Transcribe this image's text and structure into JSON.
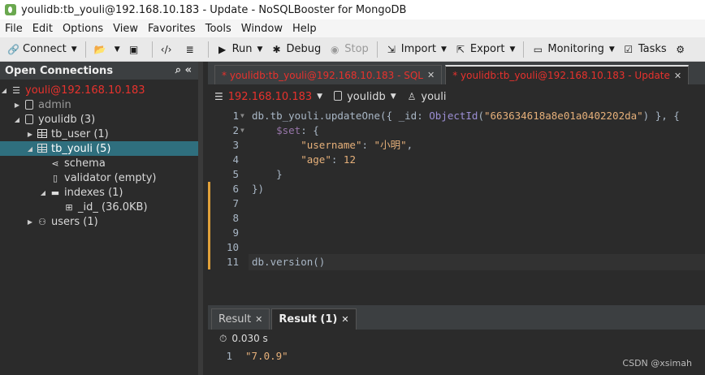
{
  "window": {
    "title": "youlidb:tb_youli@192.168.10.183 - Update - NoSQLBooster for MongoDB"
  },
  "menu": [
    "File",
    "Edit",
    "Options",
    "View",
    "Favorites",
    "Tools",
    "Window",
    "Help"
  ],
  "toolbar": {
    "connect": "Connect",
    "run": "Run",
    "debug": "Debug",
    "stop": "Stop",
    "import": "Import",
    "export": "Export",
    "monitoring": "Monitoring",
    "tasks": "Tasks"
  },
  "left_panel": {
    "title": "Open Connections",
    "tree": [
      {
        "label": "youli@192.168.10.183"
      },
      {
        "label": "admin"
      },
      {
        "label": "youlidb (3)"
      },
      {
        "label": "tb_user (1)"
      },
      {
        "label": "tb_youli (5)"
      },
      {
        "label": "schema"
      },
      {
        "label": "validator (empty)"
      },
      {
        "label": "indexes (1)"
      },
      {
        "label": "_id_ (36.0KB)"
      },
      {
        "label": "users (1)"
      }
    ]
  },
  "tabs": [
    {
      "label": "* youlidb:tb_youli@192.168.10.183 - SQL"
    },
    {
      "label": "* youlidb:tb_youli@192.168.10.183 - Update"
    }
  ],
  "connbar": {
    "host": "192.168.10.183",
    "db": "youlidb",
    "user": "youli"
  },
  "editor": {
    "lines": [
      {
        "n": "1",
        "parts": [
          [
            "db.tb_youli.updateOne({ _id: ",
            "k"
          ],
          [
            "ObjectId",
            "f"
          ],
          [
            "(",
            "k"
          ],
          [
            "\"663634618a8e01a0402202da\"",
            "s"
          ],
          [
            ") }, {",
            "k"
          ]
        ]
      },
      {
        "n": "2",
        "parts": [
          [
            "    ",
            "k"
          ],
          [
            "$set",
            "pk"
          ],
          [
            ": {",
            "k"
          ]
        ]
      },
      {
        "n": "3",
        "parts": [
          [
            "        ",
            "k"
          ],
          [
            "\"username\"",
            "s"
          ],
          [
            ": ",
            "k"
          ],
          [
            "\"小明\"",
            "s"
          ],
          [
            ",",
            "k"
          ]
        ]
      },
      {
        "n": "4",
        "parts": [
          [
            "        ",
            "k"
          ],
          [
            "\"age\"",
            "s"
          ],
          [
            ": ",
            "k"
          ],
          [
            "12",
            "n"
          ]
        ]
      },
      {
        "n": "5",
        "parts": [
          [
            "    }",
            "k"
          ]
        ]
      },
      {
        "n": "6",
        "parts": [
          [
            "})",
            "k"
          ]
        ]
      },
      {
        "n": "7",
        "parts": []
      },
      {
        "n": "8",
        "parts": []
      },
      {
        "n": "9",
        "parts": []
      },
      {
        "n": "10",
        "parts": []
      },
      {
        "n": "11",
        "parts": [
          [
            "db.version()",
            "k"
          ]
        ]
      }
    ]
  },
  "results": {
    "tabs": [
      {
        "label": "Result"
      },
      {
        "label": "Result (1)"
      }
    ],
    "time": "0.030 s",
    "rows": [
      {
        "n": "1",
        "value": "\"7.0.9\""
      }
    ]
  },
  "watermark": "CSDN @xsimah"
}
